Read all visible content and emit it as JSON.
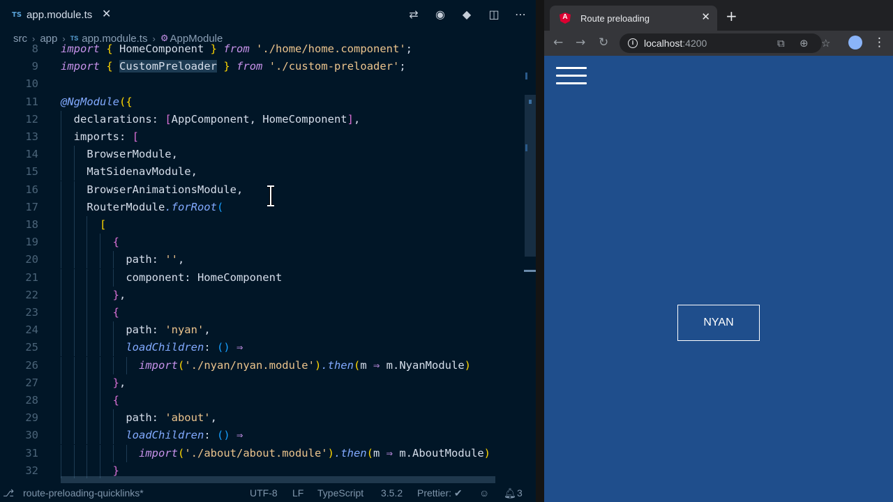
{
  "editor": {
    "tab": {
      "lang": "TS",
      "filename": "app.module.ts",
      "close": "✕"
    },
    "actions": [
      "git-compare-icon",
      "eye-icon",
      "git-icon",
      "split-editor-icon",
      "more-icon"
    ],
    "breadcrumb": [
      "src",
      "app",
      "app.module.ts",
      "AppModule"
    ],
    "breadcrumb_ts": "TS",
    "lines": [
      {
        "n": "8",
        "text": "import { HomeComponent } from './home/home.component';"
      },
      {
        "n": "9",
        "text": "import { CustomPreloader } from './custom-preloader';"
      },
      {
        "n": "10",
        "text": ""
      },
      {
        "n": "11",
        "text": "@NgModule({"
      },
      {
        "n": "12",
        "text": "  declarations: [AppComponent, HomeComponent],"
      },
      {
        "n": "13",
        "text": "  imports: ["
      },
      {
        "n": "14",
        "text": "    BrowserModule,"
      },
      {
        "n": "15",
        "text": "    MatSidenavModule,"
      },
      {
        "n": "16",
        "text": "    BrowserAnimationsModule,"
      },
      {
        "n": "17",
        "text": "    RouterModule.forRoot("
      },
      {
        "n": "18",
        "text": "      ["
      },
      {
        "n": "19",
        "text": "        {"
      },
      {
        "n": "20",
        "text": "          path: '',"
      },
      {
        "n": "21",
        "text": "          component: HomeComponent"
      },
      {
        "n": "22",
        "text": "        },"
      },
      {
        "n": "23",
        "text": "        {"
      },
      {
        "n": "24",
        "text": "          path: 'nyan',"
      },
      {
        "n": "25",
        "text": "          loadChildren: () ⇒"
      },
      {
        "n": "26",
        "text": "            import('./nyan/nyan.module').then(m ⇒ m.NyanModule)"
      },
      {
        "n": "27",
        "text": "        },"
      },
      {
        "n": "28",
        "text": "        {"
      },
      {
        "n": "29",
        "text": "          path: 'about',"
      },
      {
        "n": "30",
        "text": "          loadChildren: () ⇒"
      },
      {
        "n": "31",
        "text": "            import('./about/about.module').then(m ⇒ m.AboutModule)"
      },
      {
        "n": "32",
        "text": "        }"
      }
    ],
    "status": {
      "branch": "route-preloading-quicklinks*",
      "encoding": "UTF-8",
      "eol": "LF",
      "language": "TypeScript",
      "version": "3.5.2",
      "formatter": "Prettier: ✔",
      "notifications": "3"
    }
  },
  "browser": {
    "tab_title": "Route preloading",
    "favicon_letter": "A",
    "url_host": "localhost",
    "url_port": ":4200",
    "page": {
      "button_label": "NYAN"
    }
  },
  "colors": {
    "editor_bg": "#011627",
    "browser_page_bg": "#1f4e8c",
    "keyword": "#c792ea",
    "string": "#ecc48d",
    "function": "#82aaff"
  }
}
